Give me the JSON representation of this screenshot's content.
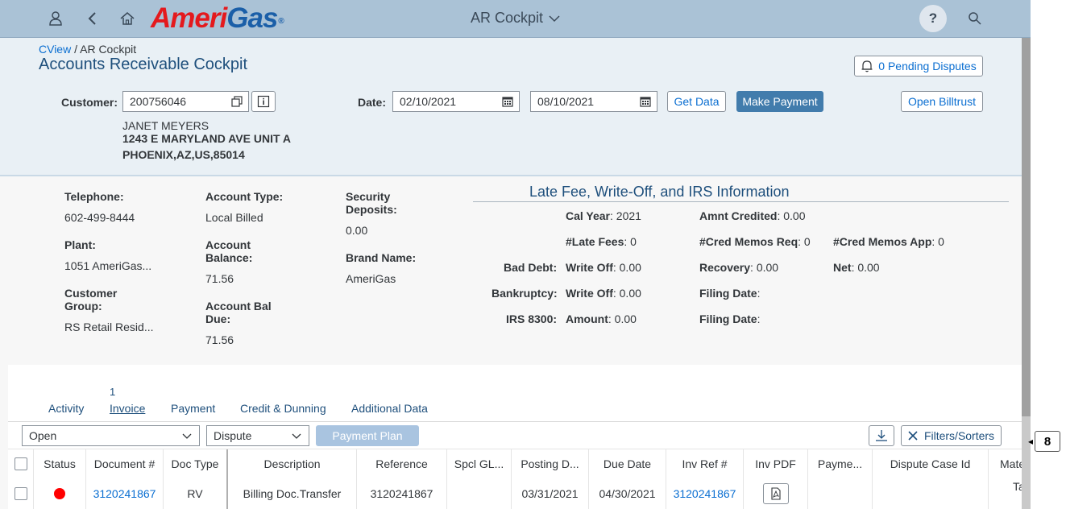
{
  "shell": {
    "logo_main": "Ameri",
    "logo_accent": "Gas",
    "logo_reg": "®",
    "app_title": "AR Cockpit",
    "help_label": "?"
  },
  "header": {
    "breadcrumb_link": "CView",
    "breadcrumb_sep": " / ",
    "breadcrumb_current": "AR Cockpit",
    "title": "Accounts Receivable Cockpit",
    "pending_disputes": "0 Pending Disputes"
  },
  "filters": {
    "customer_label": "Customer:",
    "customer_value": "200756046",
    "date_label": "Date:",
    "date_from": "02/10/2021",
    "date_to": "08/10/2021",
    "get_data": "Get Data",
    "make_payment": "Make Payment",
    "open_billtrust": "Open Billtrust"
  },
  "customer": {
    "name": "JANET MEYERS",
    "address1": "1243 E MARYLAND AVE UNIT A",
    "address2": "PHOENIX,AZ,US,85014"
  },
  "info": {
    "telephone_label": "Telephone:",
    "telephone": "602-499-8444",
    "plant_label": "Plant:",
    "plant": "1051 AmeriGas...",
    "customer_group_label": "Customer Group:",
    "customer_group": "RS Retail Resid...",
    "account_type_label": "Account Type:",
    "account_type": "Local Billed",
    "account_balance_label": "Account Balance:",
    "account_balance": "71.56",
    "account_bal_due_label": "Account Bal Due:",
    "account_bal_due": "71.56",
    "security_deposits_label": "Security Deposits:",
    "security_deposits": "0.00",
    "brand_name_label": "Brand Name:",
    "brand_name": "AmeriGas"
  },
  "late_fee": {
    "title": "Late Fee, Write-Off, and IRS Information",
    "cal_year_label": "Cal Year",
    "cal_year": ": 2021",
    "amnt_credited_label": "Amnt Credited",
    "amnt_credited": ": 0.00",
    "late_fees_label": "#Late Fees",
    "late_fees": ": 0",
    "cred_memos_req_label": "#Cred Memos Req",
    "cred_memos_req": ": 0",
    "cred_memos_app_label": "#Cred Memos App",
    "cred_memos_app": ": 0",
    "bad_debt_label": "Bad Debt:",
    "write_off_label": "Write Off",
    "bad_debt_write_off": ": 0.00",
    "recovery_label": "Recovery",
    "recovery": ": 0.00",
    "net_label": "Net",
    "net": ": 0.00",
    "bankruptcy_label": "Bankruptcy:",
    "bankruptcy_write_off": ": 0.00",
    "filing_date_label": "Filing Date",
    "colon": ":",
    "irs_label": "IRS 8300:",
    "amount_label": "Amount",
    "amount": ": 0.00"
  },
  "tabs": {
    "invoice_count": "1",
    "items": [
      "Activity",
      "Invoice",
      "Payment",
      "Credit & Dunning",
      "Additional Data"
    ],
    "active": "Invoice"
  },
  "toolbar": {
    "status_select": "Open",
    "dispute_select": "Dispute",
    "payment_plan": "Payment Plan",
    "filters_sorters": "Filters/Sorters",
    "badge": "8"
  },
  "table": {
    "columns": [
      "Status",
      "Document #",
      "Doc Type",
      "Description",
      "Reference",
      "Spcl GL...",
      "Posting D...",
      "Due Date",
      "Inv Ref #",
      "Inv PDF",
      "Payme...",
      "Dispute Case Id",
      "Mate"
    ],
    "rows": [
      {
        "status_color": "#ff0000",
        "document": "3120241867",
        "doc_type": "RV",
        "description": "Billing Doc.Transfer",
        "reference": "3120241867",
        "spcl_gl": "",
        "posting_date": "03/31/2021",
        "due_date": "04/30/2021",
        "inv_ref": "3120241867",
        "payment": "",
        "dispute_case": "",
        "material": "Tar"
      }
    ]
  }
}
